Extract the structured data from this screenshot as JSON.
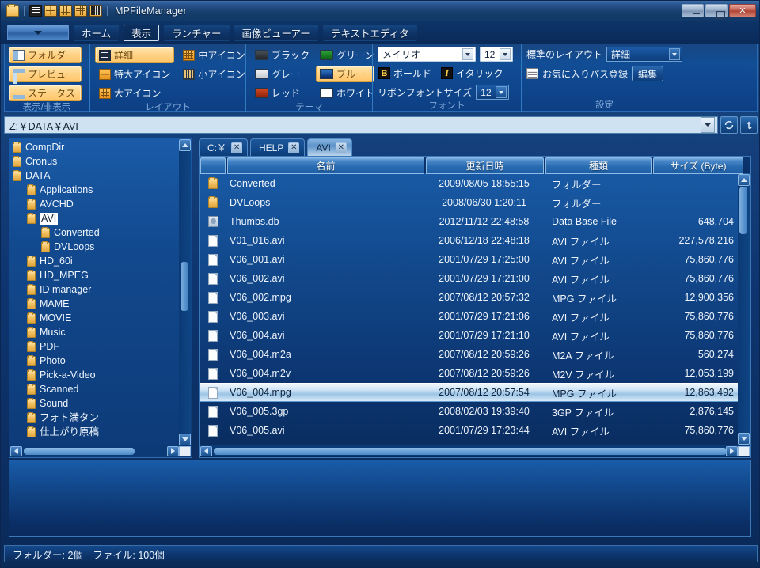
{
  "window": {
    "title": "MPFileManager",
    "titlebar_icons": [
      "folder-icon",
      "detail-view-icon",
      "extra-large-icon",
      "large-icon",
      "medium-icon",
      "small-icon"
    ],
    "controls": {
      "minimize": "–",
      "maximize": "□",
      "close": "✕"
    }
  },
  "ribbon_tabs": {
    "app_menu_label": "",
    "items": [
      {
        "label": "ホーム",
        "active": false
      },
      {
        "label": "表示",
        "active": true
      },
      {
        "label": "ランチャー",
        "active": false
      },
      {
        "label": "画像ビューアー",
        "active": false
      },
      {
        "label": "テキストエディタ",
        "active": false
      }
    ]
  },
  "ribbon": {
    "groups": [
      {
        "name": "visibility",
        "label": "表示/非表示",
        "items": [
          {
            "label": "フォルダー",
            "icon": "pane-left-icon",
            "selected": true
          },
          {
            "label": "プレビュー",
            "icon": "pane-top-icon",
            "selected": true
          },
          {
            "label": "ステータス",
            "icon": "pane-bottom-icon",
            "selected": true
          }
        ]
      },
      {
        "name": "layout",
        "label": "レイアウト",
        "col1": [
          {
            "label": "詳細",
            "icon": "detail-view-icon",
            "selected": true
          },
          {
            "label": "特大アイコン",
            "icon": "extra-large-icon",
            "selected": false
          },
          {
            "label": "大アイコン",
            "icon": "large-icon",
            "selected": false
          }
        ],
        "col2": [
          {
            "label": "中アイコン",
            "icon": "medium-icon",
            "selected": false
          },
          {
            "label": "小アイコン",
            "icon": "small-icon",
            "selected": false
          }
        ]
      },
      {
        "name": "theme",
        "label": "テーマ",
        "col1": [
          {
            "label": "ブラック",
            "color": "#2e3338",
            "selected": false
          },
          {
            "label": "グレー",
            "color": "#d3d8dd",
            "selected": false
          },
          {
            "label": "レッド",
            "color": "#a82d12",
            "selected": false
          }
        ],
        "col2": [
          {
            "label": "グリーン",
            "color": "#18761f",
            "selected": false
          },
          {
            "label": "ブルー",
            "color": "#0c3f8f",
            "selected": true
          },
          {
            "label": "ホワイト",
            "color": "#ffffff",
            "selected": false
          }
        ]
      },
      {
        "name": "font",
        "label": "フォント",
        "font_family": "メイリオ",
        "font_size": "12",
        "bold_label": "ボールド",
        "bold_glyph": "B",
        "italic_label": "イタリック",
        "italic_glyph": "I",
        "ribbon_font_size_label": "リボンフォントサイズ",
        "ribbon_font_size": "12"
      },
      {
        "name": "settings",
        "label": "設定",
        "default_layout_label": "標準のレイアウト",
        "default_layout_value": "詳細",
        "favorite_path_label": "お気に入りパス登録",
        "edit_button": "編集"
      }
    ]
  },
  "address_bar": {
    "path": "Z:￥DATA￥AVI",
    "dropdown_icon": "chevron-down-icon",
    "refresh_icon": "refresh-icon",
    "up_icon": "up-arrow-icon"
  },
  "tree": {
    "nodes": [
      {
        "label": "CompDir",
        "depth": 1,
        "selected": false
      },
      {
        "label": "Cronus",
        "depth": 1,
        "selected": false
      },
      {
        "label": "DATA",
        "depth": 1,
        "selected": false
      },
      {
        "label": "Applications",
        "depth": 2,
        "selected": false
      },
      {
        "label": "AVCHD",
        "depth": 2,
        "selected": false
      },
      {
        "label": "AVI",
        "depth": 2,
        "selected": true
      },
      {
        "label": "Converted",
        "depth": 3,
        "selected": false
      },
      {
        "label": "DVLoops",
        "depth": 3,
        "selected": false
      },
      {
        "label": "HD_60i",
        "depth": 2,
        "selected": false
      },
      {
        "label": "HD_MPEG",
        "depth": 2,
        "selected": false
      },
      {
        "label": "ID manager",
        "depth": 2,
        "selected": false
      },
      {
        "label": "MAME",
        "depth": 2,
        "selected": false
      },
      {
        "label": "MOVIE",
        "depth": 2,
        "selected": false
      },
      {
        "label": "Music",
        "depth": 2,
        "selected": false
      },
      {
        "label": "PDF",
        "depth": 2,
        "selected": false
      },
      {
        "label": "Photo",
        "depth": 2,
        "selected": false
      },
      {
        "label": "Pick-a-Video",
        "depth": 2,
        "selected": false
      },
      {
        "label": "Scanned",
        "depth": 2,
        "selected": false
      },
      {
        "label": "Sound",
        "depth": 2,
        "selected": false
      },
      {
        "label": "フォト満タン",
        "depth": 2,
        "selected": false
      },
      {
        "label": "仕上がり原稿",
        "depth": 2,
        "selected": false
      }
    ]
  },
  "file_tabs": [
    {
      "label": "C:￥",
      "active": false,
      "close": "✕"
    },
    {
      "label": "HELP",
      "active": false,
      "close": "✕"
    },
    {
      "label": "AVI",
      "active": true,
      "close": "✕"
    }
  ],
  "file_list": {
    "columns": [
      "",
      "名前",
      "更新日時",
      "種類",
      "サイズ (Byte)"
    ],
    "rows": [
      {
        "icon": "folder-icon",
        "name": "Converted",
        "date": "2009/08/05 18:55:15",
        "type": "フォルダー",
        "size": "",
        "selected": false
      },
      {
        "icon": "folder-icon",
        "name": "DVLoops",
        "date": "2008/06/30 1:20:11",
        "type": "フォルダー",
        "size": "",
        "selected": false
      },
      {
        "icon": "db-icon",
        "name": "Thumbs.db",
        "date": "2012/11/12 22:48:58",
        "type": "Data Base File",
        "size": "648,704",
        "selected": false
      },
      {
        "icon": "file-icon",
        "name": "V01_016.avi",
        "date": "2006/12/18 22:48:18",
        "type": "AVI ファイル",
        "size": "227,578,216",
        "selected": false
      },
      {
        "icon": "file-icon",
        "name": "V06_001.avi",
        "date": "2001/07/29 17:25:00",
        "type": "AVI ファイル",
        "size": "75,860,776",
        "selected": false
      },
      {
        "icon": "file-icon",
        "name": "V06_002.avi",
        "date": "2001/07/29 17:21:00",
        "type": "AVI ファイル",
        "size": "75,860,776",
        "selected": false
      },
      {
        "icon": "file-icon",
        "name": "V06_002.mpg",
        "date": "2007/08/12 20:57:32",
        "type": "MPG ファイル",
        "size": "12,900,356",
        "selected": false
      },
      {
        "icon": "file-icon",
        "name": "V06_003.avi",
        "date": "2001/07/29 17:21:06",
        "type": "AVI ファイル",
        "size": "75,860,776",
        "selected": false
      },
      {
        "icon": "file-icon",
        "name": "V06_004.avi",
        "date": "2001/07/29 17:21:10",
        "type": "AVI ファイル",
        "size": "75,860,776",
        "selected": false
      },
      {
        "icon": "file-icon",
        "name": "V06_004.m2a",
        "date": "2007/08/12 20:59:26",
        "type": "M2A ファイル",
        "size": "560,274",
        "selected": false
      },
      {
        "icon": "file-icon",
        "name": "V06_004.m2v",
        "date": "2007/08/12 20:59:26",
        "type": "M2V ファイル",
        "size": "12,053,199",
        "selected": false
      },
      {
        "icon": "file-icon",
        "name": "V06_004.mpg",
        "date": "2007/08/12 20:57:54",
        "type": "MPG ファイル",
        "size": "12,863,492",
        "selected": true
      },
      {
        "icon": "file-icon",
        "name": "V06_005.3gp",
        "date": "2008/02/03 19:39:40",
        "type": "3GP ファイル",
        "size": "2,876,145",
        "selected": false
      },
      {
        "icon": "file-icon",
        "name": "V06_005.avi",
        "date": "2001/07/29 17:23:44",
        "type": "AVI ファイル",
        "size": "75,860,776",
        "selected": false
      }
    ]
  },
  "status_bar": {
    "text": "フォルダー: 2個　ファイル: 100個"
  }
}
